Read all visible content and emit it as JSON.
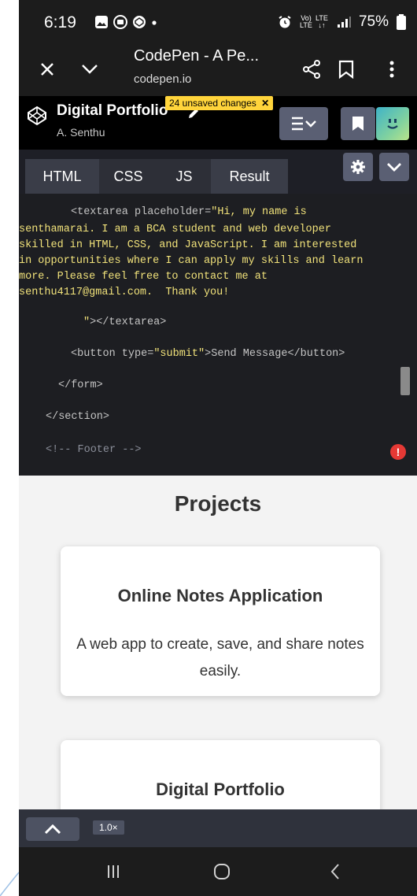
{
  "status": {
    "time": "6:19",
    "battery": "75%",
    "network": "LTE",
    "volte": "VoLTE"
  },
  "browser": {
    "title": "CodePen - A Pe...",
    "url": "codepen.io"
  },
  "codepen": {
    "pen_title": "Digital Portfolio",
    "author": "A. Senthu",
    "unsaved": "24 unsaved changes"
  },
  "tabs": [
    "HTML",
    "CSS",
    "JS",
    "Result"
  ],
  "code": {
    "l1a": "<textarea placeholder=",
    "l1b": "\"Hi, my name is",
    "l2": "senthamarai. I am a BCA student and web developer",
    "l3": "skilled in HTML, CSS, and JavaScript. I am interested",
    "l4": "in opportunities where I can apply my skills and learn",
    "l5": "more. Please feel free to contact me at",
    "l6": "senthu4117@gmail.com.  Thank you!",
    "l7a": "\"",
    "l7b": "></textarea>",
    "l8a": "<button type=",
    "l8b": "\"submit\"",
    "l8c": ">Send Message</button>",
    "l9": "</form>",
    "l10": "</section>",
    "l11": "<!-- Footer -->"
  },
  "result": {
    "heading": "Projects",
    "cards": [
      {
        "title": "Online Notes Application",
        "desc": "A web app to create, save, and share notes easily."
      },
      {
        "title": "Digital Portfolio"
      }
    ]
  },
  "bottom": {
    "zoom": "1.0×"
  },
  "colors": {
    "accent_yellow": "#ffd43b",
    "error_red": "#e53935",
    "editor_bg": "#1d1e22"
  }
}
